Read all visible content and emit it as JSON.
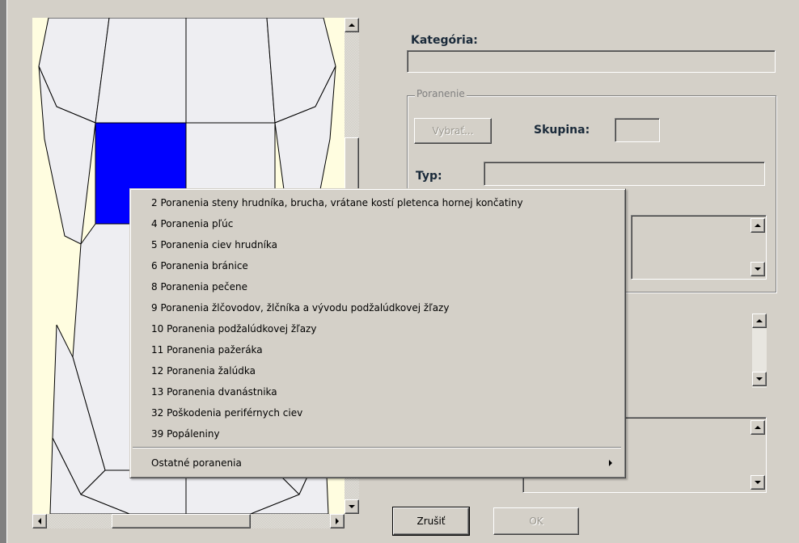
{
  "form": {
    "kategoria_label": "Kategória:",
    "poranenie_group": "Poranenie",
    "vybrat_button": "Vybrať...",
    "skupina_label": "Skupina:",
    "typ_label": "Typ:",
    "zrusit_button": "Zrušiť",
    "ok_button": "OK"
  },
  "context_menu": {
    "items": [
      "2 Poranenia steny hrudníka, brucha, vrátane kostí pletenca hornej končatiny",
      "4 Poranenia pľúc",
      "5 Poranenia ciev hrudníka",
      "6 Poranenia bránice",
      "8 Poranenia pečene",
      "9 Poranenia žlčovodov, žlčníka a vývodu podžalúdkovej žľazy",
      "10 Poranenia podžalúdkovej žľazy",
      "11 Poranenia pažeráka",
      "12 Poranenia žalúdka",
      "13 Poranenia dvanástnika",
      "32 Poškodenia periférnych ciev",
      "39 Popáleniny"
    ],
    "submenu_label": "Ostatné poranenia"
  },
  "icons": {
    "scroll_up": "triangle-up-icon",
    "scroll_down": "triangle-down-icon",
    "scroll_left": "triangle-left-icon",
    "scroll_right": "triangle-right-icon",
    "submenu": "triangle-right-icon"
  },
  "colors": {
    "selected_region": "#0000ff",
    "region_fill": "#eeeef2",
    "background_fill": "#fffde0"
  }
}
